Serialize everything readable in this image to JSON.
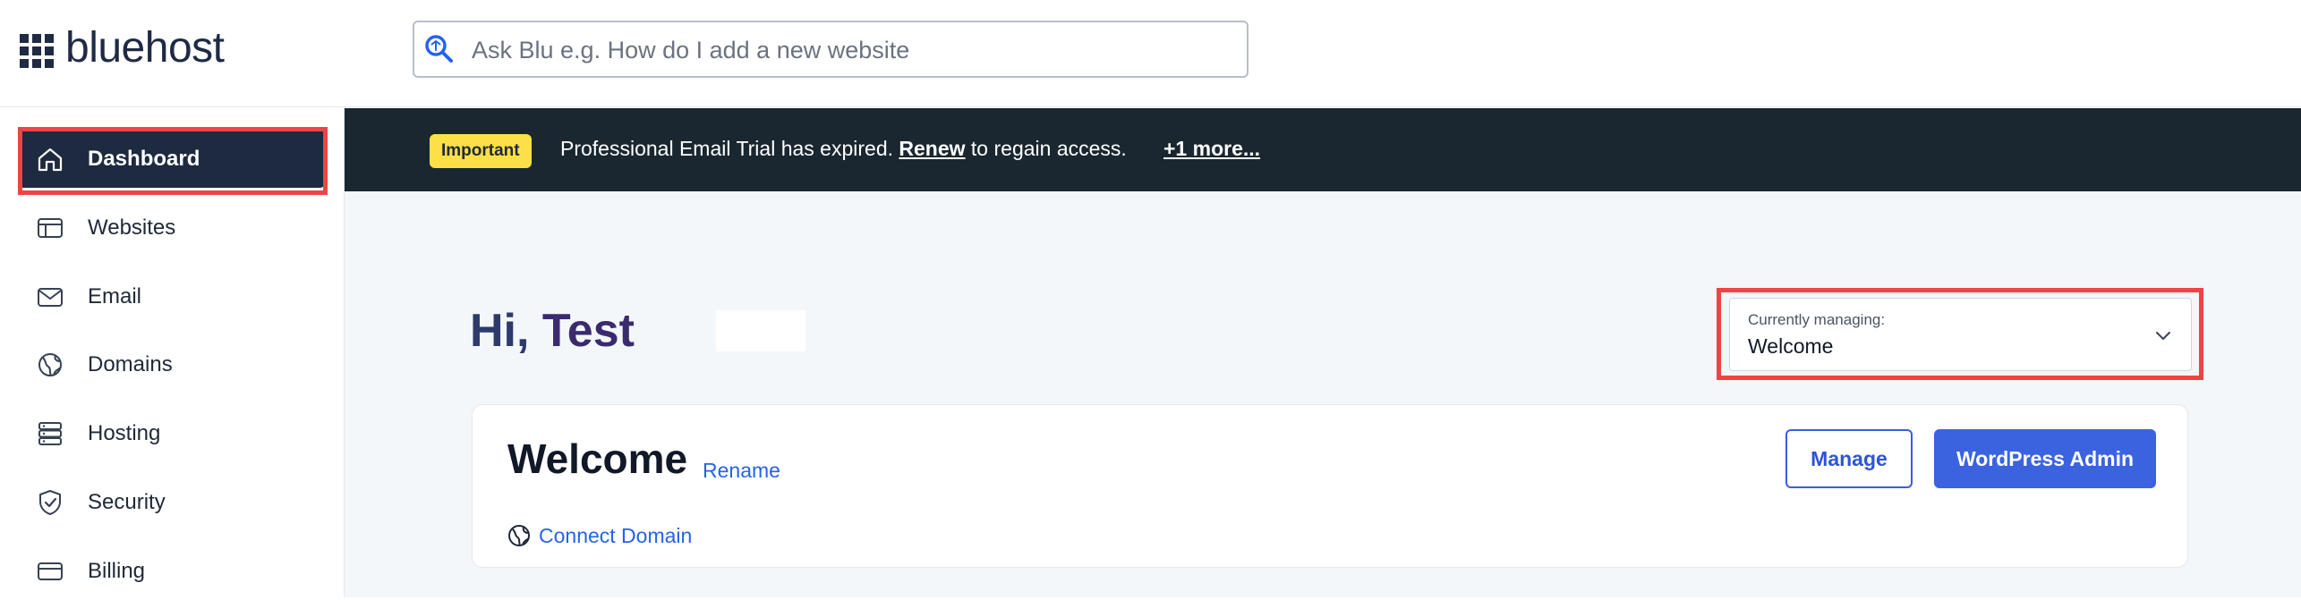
{
  "header": {
    "brand": "bluehost",
    "search": {
      "placeholder": "Ask Blu e.g. How do I add a new website"
    }
  },
  "sidebar": {
    "items": [
      {
        "label": "Dashboard",
        "icon": "home-icon",
        "active": true
      },
      {
        "label": "Websites",
        "icon": "browser-window-icon"
      },
      {
        "label": "Email",
        "icon": "mail-icon"
      },
      {
        "label": "Domains",
        "icon": "globe-icon"
      },
      {
        "label": "Hosting",
        "icon": "server-icon"
      },
      {
        "label": "Security",
        "icon": "shield-check-icon"
      },
      {
        "label": "Billing",
        "icon": "credit-card-icon"
      }
    ]
  },
  "banner": {
    "badge": "Important",
    "message_before": "Professional Email Trial has expired.",
    "link": "Renew",
    "message_after": "to regain access.",
    "more": "+1 more..."
  },
  "main": {
    "greeting_hi": "Hi,",
    "greeting_name": "Test",
    "managing": {
      "label": "Currently managing:",
      "value": "Welcome"
    },
    "card": {
      "title": "Welcome",
      "rename": "Rename",
      "connect_domain": "Connect Domain",
      "manage_label": "Manage",
      "wp_admin_label": "WordPress Admin"
    }
  },
  "colors": {
    "accent": "#3b63e0",
    "banner_bg": "#1a2730",
    "badge_bg": "#fde047",
    "highlight": "#ef4444",
    "sidebar_active": "#1e2a3f"
  }
}
